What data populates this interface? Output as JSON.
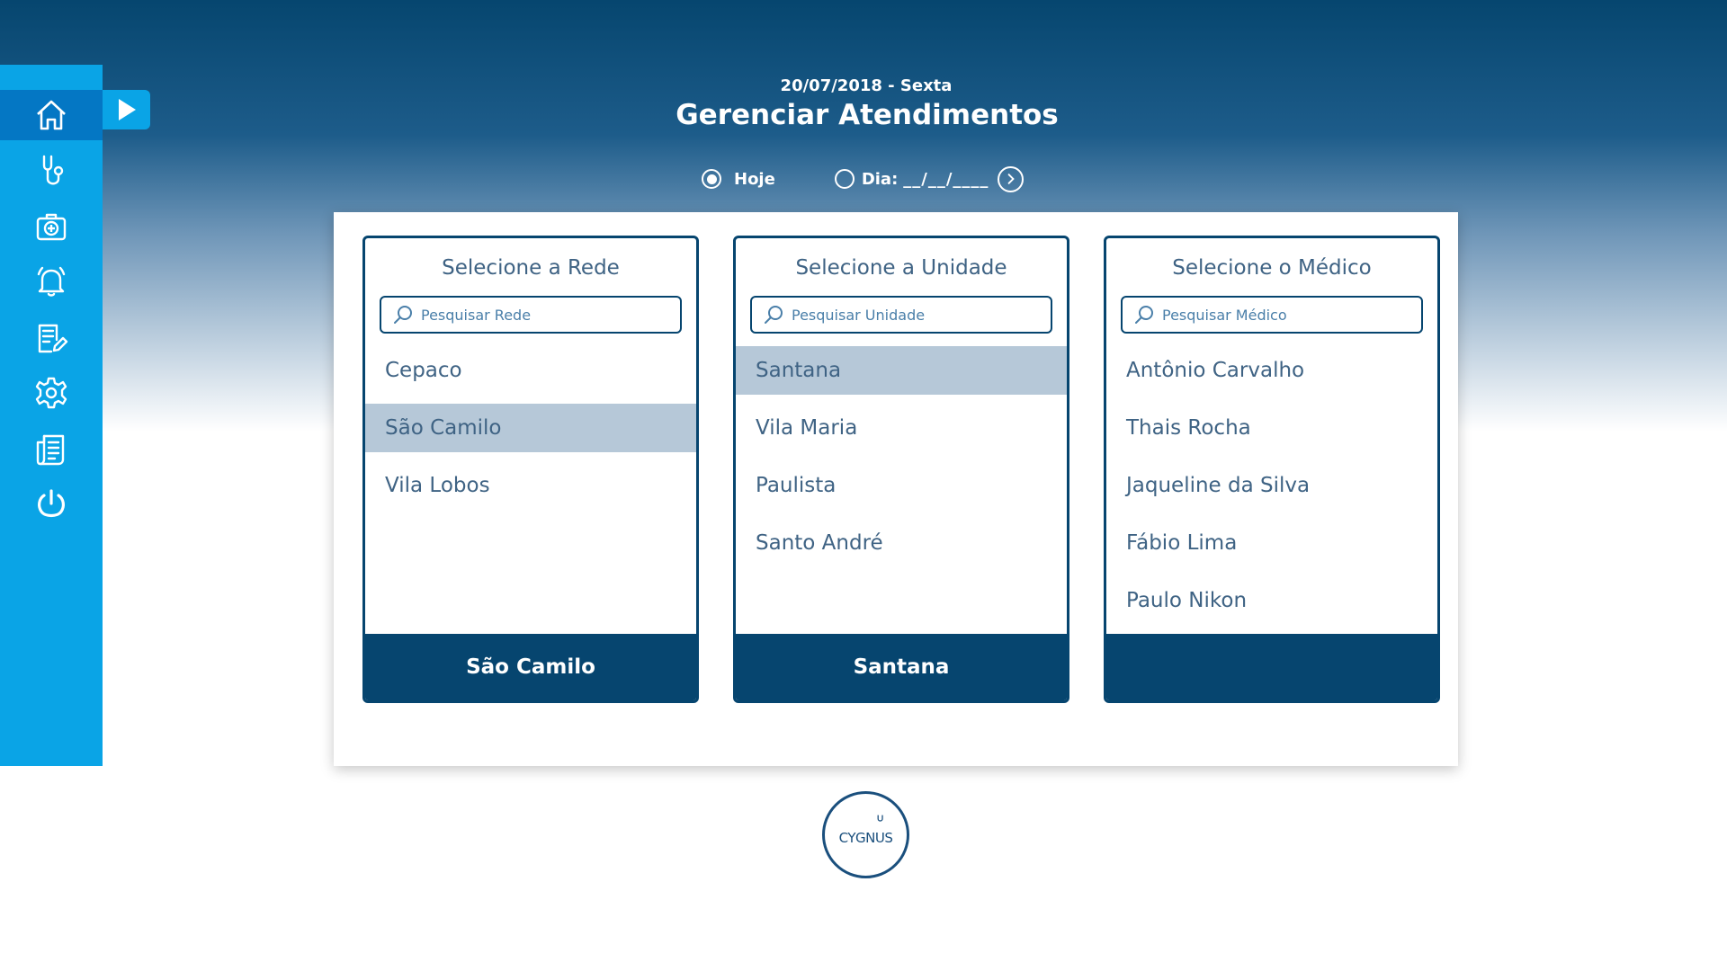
{
  "header": {
    "date": "20/07/2018 - Sexta",
    "title": "Gerenciar Atendimentos"
  },
  "date_filter": {
    "today_label": "Hoje",
    "day_label": "Dia:",
    "day_value": "__/__/____",
    "selected": "today"
  },
  "sidebar": {
    "items": [
      {
        "icon": "home-icon",
        "active": true
      },
      {
        "icon": "stethoscope-icon",
        "active": false
      },
      {
        "icon": "medical-kit-icon",
        "active": false
      },
      {
        "icon": "bell-icon",
        "active": false
      },
      {
        "icon": "edit-document-icon",
        "active": false
      },
      {
        "icon": "gear-icon",
        "active": false
      },
      {
        "icon": "documents-icon",
        "active": false
      },
      {
        "icon": "power-icon",
        "active": false
      }
    ]
  },
  "columns": [
    {
      "title": "Selecione a Rede",
      "placeholder": "Pesquisar Rede",
      "items": [
        "Cepaco",
        "São Camilo",
        "Vila Lobos"
      ],
      "selected_index": 1,
      "footer": "São Camilo"
    },
    {
      "title": "Selecione a Unidade",
      "placeholder": "Pesquisar Unidade",
      "items": [
        "Santana",
        "Vila Maria",
        "Paulista",
        "Santo André"
      ],
      "selected_index": 0,
      "footer": "Santana"
    },
    {
      "title": "Selecione o Médico",
      "placeholder": "Pesquisar Médico",
      "items": [
        "Antônio Carvalho",
        "Thais Rocha",
        "Jaqueline da Silva",
        "Fábio Lima",
        "Paulo Nikon"
      ],
      "selected_index": -1,
      "footer": ""
    }
  ],
  "logo": {
    "text": "CYGNUS"
  },
  "colors": {
    "navy": "#06456f",
    "sidebar": "#0aa4e6",
    "sidebar_active": "#0477c4",
    "selected_row": "#b6c8d8",
    "text": "#3f6384"
  }
}
